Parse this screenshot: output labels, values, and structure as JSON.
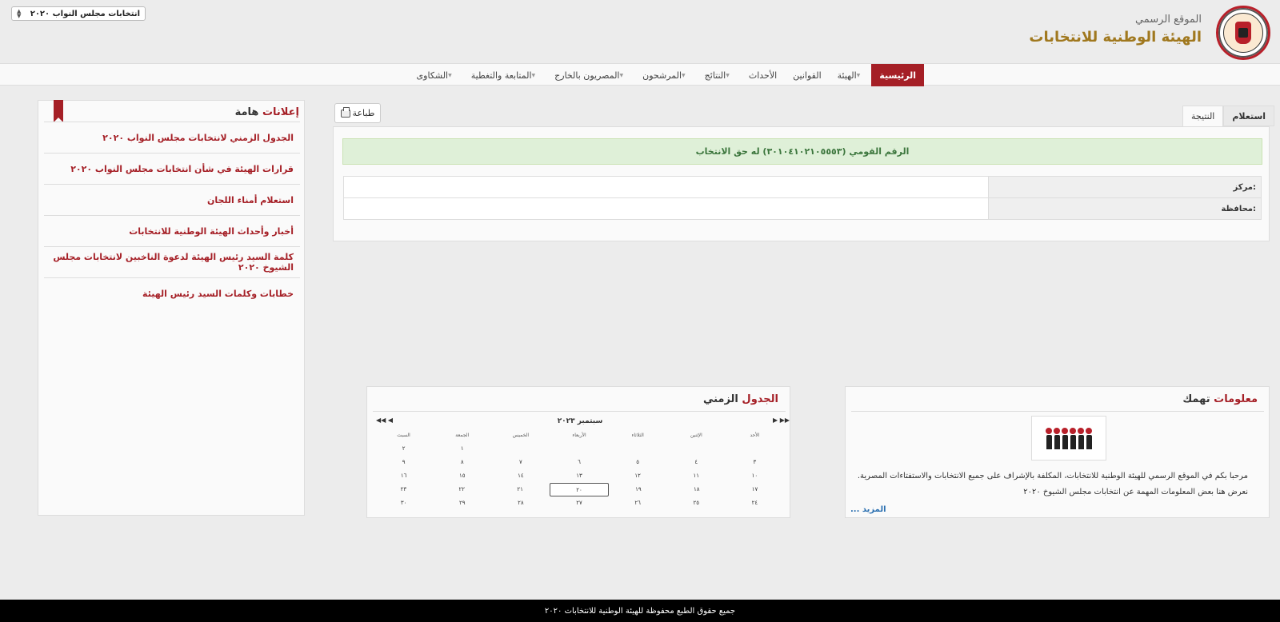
{
  "header": {
    "subtitle": "الموقع الرسمي",
    "title": "الهيئة الوطنية للانتخابات",
    "election_select": "انتخابات مجلس النواب ٢٠٢٠"
  },
  "nav": {
    "items": [
      {
        "label": "الرئيسية",
        "active": true,
        "caret": false
      },
      {
        "label": "الهيئة",
        "caret": true
      },
      {
        "label": "القوانين",
        "caret": false
      },
      {
        "label": "الأحداث",
        "caret": false
      },
      {
        "label": "النتائج",
        "caret": true
      },
      {
        "label": "المرشحون",
        "caret": true
      },
      {
        "label": "المصريون بالخارج",
        "caret": true
      },
      {
        "label": "المتابعة والتغطية",
        "caret": true
      },
      {
        "label": "الشكاوى",
        "caret": true
      }
    ]
  },
  "result": {
    "tabs": [
      "استعلام",
      "النتيجة"
    ],
    "print_label": "طباعة",
    "alert": "الرقم القومي (٣٠١٠٤١٠٢١٠٥٥٥٣) له حق الانتخاب",
    "rows": [
      {
        "label": "مركز:",
        "value": ""
      },
      {
        "label": "محافظة:",
        "value": ""
      }
    ]
  },
  "announcements": {
    "title_a": "إعلانات",
    "title_b": "هامة",
    "items": [
      "الجدول الزمني لانتخابات مجلس النواب ٢٠٢٠",
      "قرارات الهيئة في شأن انتخابات مجلس النواب ٢٠٢٠",
      "استعلام أمناء  اللجان",
      "أخبار وأحداث الهيئة الوطنية للانتخابات",
      "كلمة السيد رئيس الهيئة لدعوة الناخبين لانتخابات مجلس الشيوخ ٢٠٢٠",
      "خطابات وكلمات السيد رئيس الهيئة"
    ]
  },
  "info": {
    "title_a": "معلومات",
    "title_b": "تهمك",
    "text1": "مرحبا بكم في الموقع الرسمي للهيئة الوطنية للانتخابات، المكلفة بالإشراف على جميع الانتخابات والاستفتاءات المصرية.",
    "text2": "نعرض هنا بعض المعلومات المهمة عن  انتخابات مجلس الشيوخ ٢٠٢٠",
    "more": "المزيد ..."
  },
  "calendar": {
    "title_a": "الجدول",
    "title_b": "الزمني",
    "month": "سبتمبر ٢٠٢٣",
    "prev": "◀◀ ◀",
    "next": "▶ ▶▶",
    "weekdays": [
      "الأحد",
      "الإثنين",
      "الثلاثاء",
      "الأربعاء",
      "الخميس",
      "الجمعة",
      "السبت"
    ],
    "weeks": [
      [
        "",
        "",
        "",
        "",
        "",
        "١",
        "٢"
      ],
      [
        "٣",
        "٤",
        "٥",
        "٦",
        "٧",
        "٨",
        "٩"
      ],
      [
        "١٠",
        "١١",
        "١٢",
        "١٣",
        "١٤",
        "١٥",
        "١٦"
      ],
      [
        "١٧",
        "١٨",
        "١٩",
        "٢٠",
        "٢١",
        "٢٢",
        "٢٣"
      ],
      [
        "٢٤",
        "٢٥",
        "٢٦",
        "٢٧",
        "٢٨",
        "٢٩",
        "٣٠"
      ]
    ],
    "today": "٢٠"
  },
  "footer": {
    "text": "جميع حقوق الطبع محفوظة للهيئة الوطنية للانتخابات ٢٠٢٠"
  }
}
